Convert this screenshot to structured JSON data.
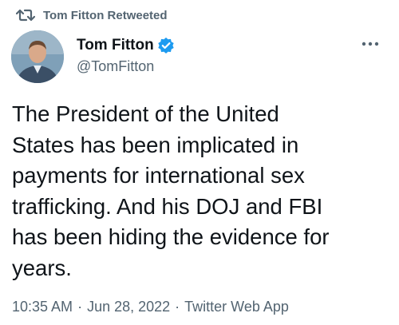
{
  "retweet": {
    "icon": "retweet-icon",
    "label": "Tom Fitton Retweeted"
  },
  "author": {
    "name": "Tom Fitton",
    "handle": "@TomFitton",
    "verified_icon": "verified-badge-icon",
    "verified_color": "#1d9bf0",
    "avatar": "avatar-photo"
  },
  "more_icon": "more-options-icon",
  "tweet": {
    "lines": [
      "The President of the United",
      "States has been implicated in",
      "payments for international sex",
      "trafficking. And his DOJ and FBI",
      "has been hiding the evidence for",
      "years."
    ]
  },
  "meta": {
    "time": "10:35 AM",
    "separator": "·",
    "date": "Jun 28, 2022",
    "source": "Twitter Web App"
  },
  "colors": {
    "text_primary": "#0f1419",
    "text_secondary": "#536471",
    "accent": "#1d9bf0"
  }
}
